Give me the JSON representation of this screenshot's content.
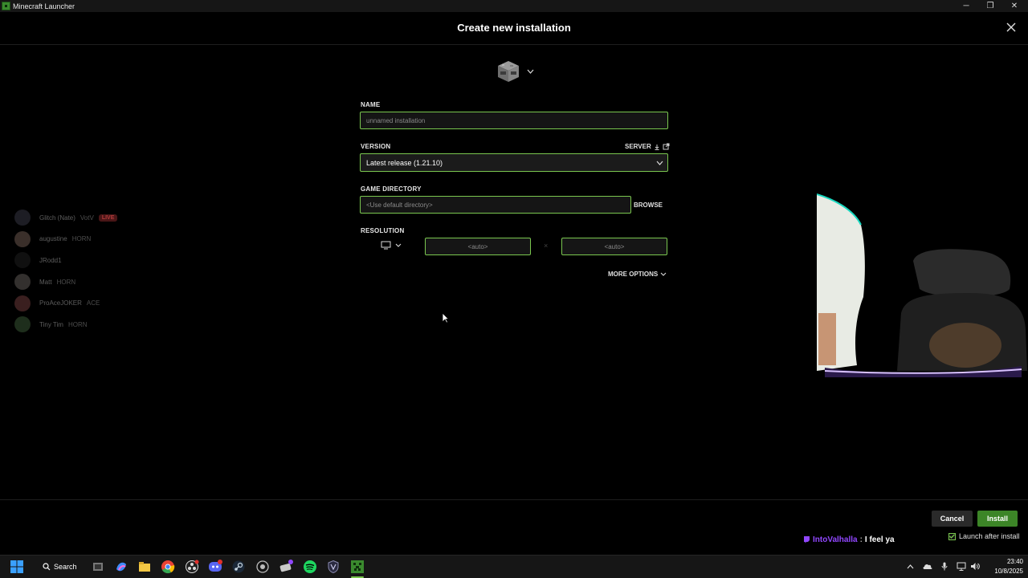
{
  "window": {
    "title": "Minecraft Launcher",
    "minimize": "─",
    "maximize": "❐",
    "close": "✕"
  },
  "dialog": {
    "title": "Create new installation"
  },
  "form": {
    "name_label": "NAME",
    "name_placeholder": "unnamed installation",
    "version_label": "VERSION",
    "server_link": "SERVER",
    "version_value": "Latest release (1.21.10)",
    "directory_label": "GAME DIRECTORY",
    "directory_placeholder": "<Use default directory>",
    "browse_label": "BROWSE",
    "resolution_label": "RESOLUTION",
    "res_width_placeholder": "<auto>",
    "res_height_placeholder": "<auto>",
    "res_separator": "×",
    "more_options": "MORE OPTIONS"
  },
  "sidebar": {
    "items": [
      {
        "name": "Glitch (Nate)",
        "badge": "VotV",
        "live": "LIVE"
      },
      {
        "name": "augustine",
        "badge": "HORN"
      },
      {
        "name": "JRodd1"
      },
      {
        "name": "Matt",
        "badge": "HORN"
      },
      {
        "name": "ProAceJOKER",
        "badge": "ACE"
      },
      {
        "name": "Tiny Tim",
        "badge": "HORN"
      }
    ]
  },
  "footer": {
    "cancel": "Cancel",
    "install": "Install",
    "launch_after_install": "Launch after install",
    "launch_after_install_checked": true
  },
  "chat": {
    "user": "IntoValhalla",
    "separator": ":",
    "message": "I feel ya"
  },
  "taskbar": {
    "search_label": "Search",
    "time": "23:40",
    "date": "10/8/2025"
  },
  "colors": {
    "accent_green": "#7ac74f",
    "install_green": "#3c8527",
    "twitch_purple": "#9147ff",
    "background": "#000000"
  }
}
